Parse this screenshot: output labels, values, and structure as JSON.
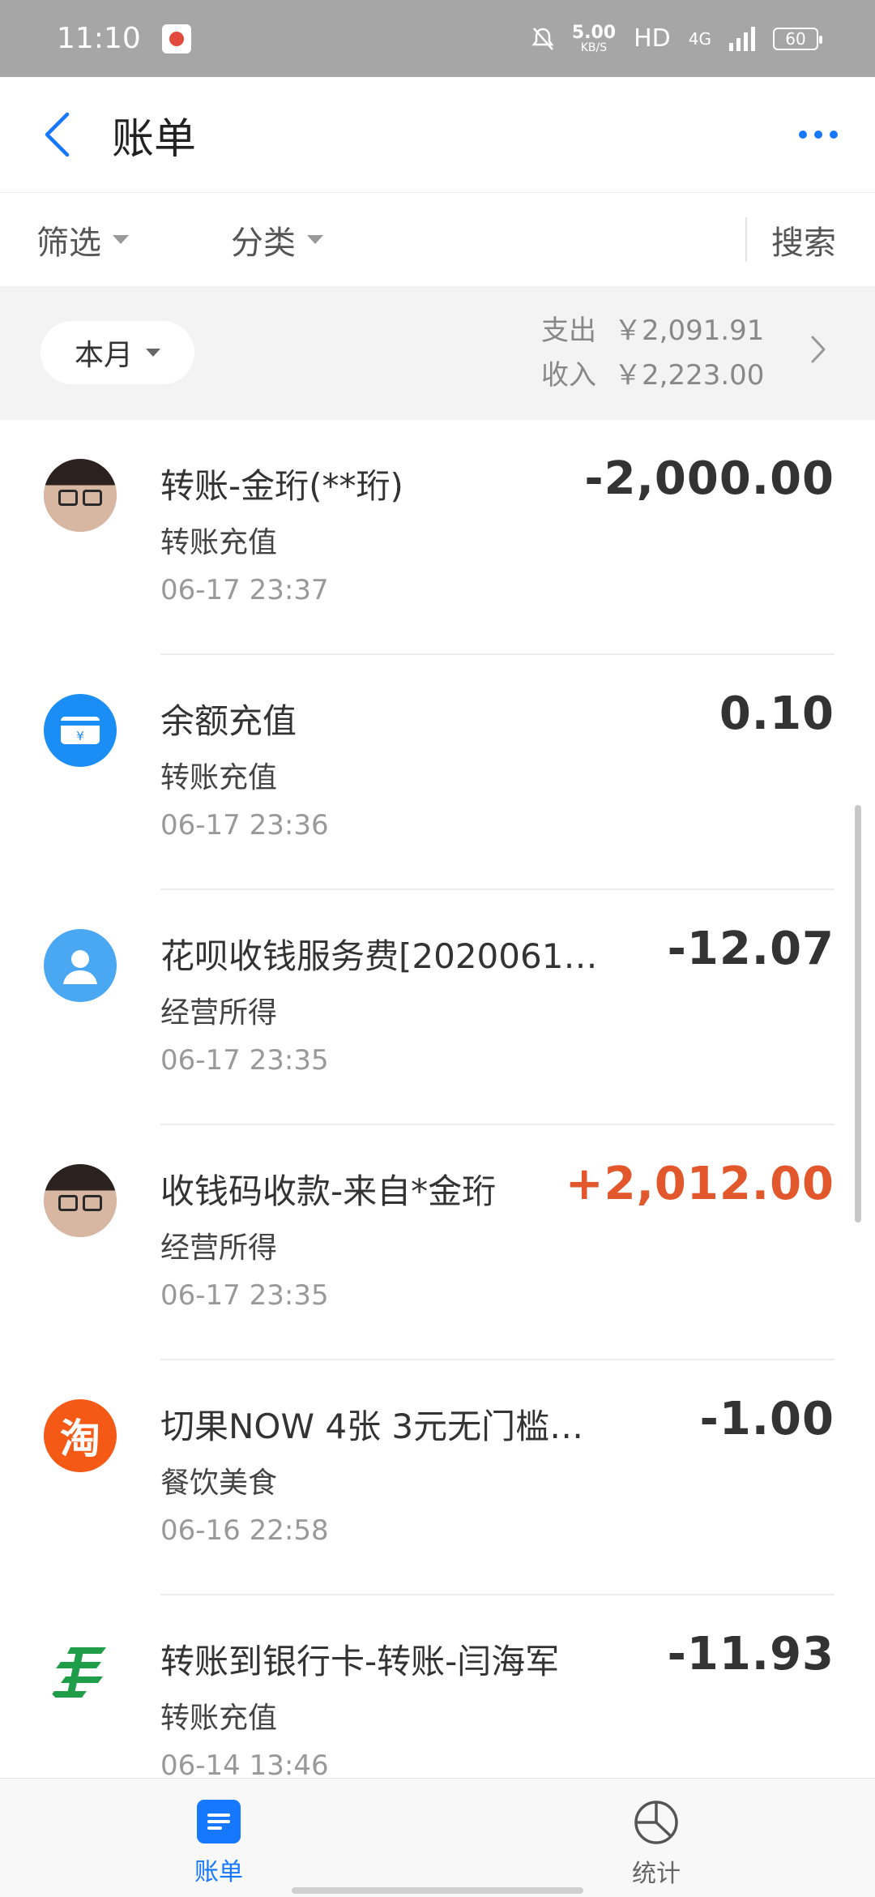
{
  "status_bar": {
    "time": "11:10",
    "net_speed": "5.00",
    "net_unit": "KB/S",
    "hd_label": "HD",
    "signal_label": "4G",
    "battery": "60"
  },
  "header": {
    "title": "账单"
  },
  "filters": {
    "filter_label": "筛选",
    "category_label": "分类",
    "search_label": "搜索"
  },
  "summary": {
    "period_label": "本月",
    "expense_label": "支出",
    "expense_value": "￥2,091.91",
    "income_label": "收入",
    "income_value": "￥2,223.00"
  },
  "transactions": [
    {
      "title": "转账-金珩(**珩)",
      "category": "转账充值",
      "date": "06-17",
      "time": "23:37",
      "amount": "-2,000.00",
      "icon": "user-photo-avatar",
      "positive": false
    },
    {
      "title": "余额充值",
      "category": "转账充值",
      "date": "06-17",
      "time": "23:36",
      "amount": "0.10",
      "icon": "yuan-card-icon",
      "positive": false
    },
    {
      "title": "花呗收钱服务费[2020061…",
      "category": "经营所得",
      "date": "06-17",
      "time": "23:35",
      "amount": "-12.07",
      "icon": "person-icon",
      "positive": false
    },
    {
      "title": "收钱码收款-来自*金珩",
      "category": "经营所得",
      "date": "06-17",
      "time": "23:35",
      "amount": "+2,012.00",
      "icon": "user-photo-avatar",
      "positive": true
    },
    {
      "title": "切果NOW 4张 3元无门槛…",
      "category": "餐饮美食",
      "date": "06-16",
      "time": "22:58",
      "amount": "-1.00",
      "icon": "taobao-icon",
      "positive": false
    },
    {
      "title": "转账到银行卡-转账-闫海军",
      "category": "转账充值",
      "date": "06-14",
      "time": "13:46",
      "amount": "-11.93",
      "icon": "postal-bank-icon",
      "positive": false
    }
  ],
  "taobao_glyph": "淘",
  "colors": {
    "accent": "#1677ff",
    "positive_amount": "#e2572c"
  },
  "bottom_nav": {
    "bills_label": "账单",
    "stats_label": "统计"
  }
}
